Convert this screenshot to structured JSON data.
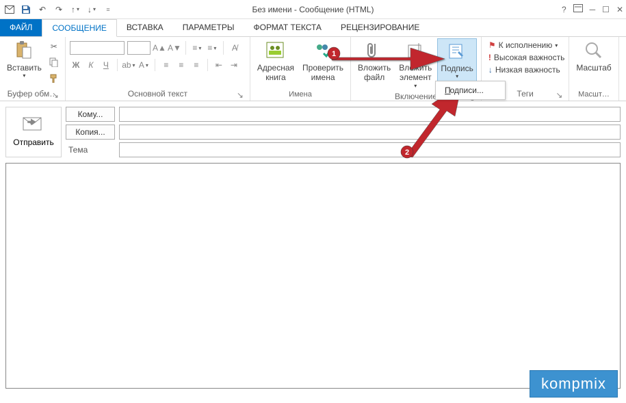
{
  "window": {
    "title": "Без имени - Сообщение (HTML)"
  },
  "tabs": {
    "file": "ФАЙЛ",
    "message": "СООБЩЕНИЕ",
    "insert": "ВСТАВКА",
    "options": "ПАРАМЕТРЫ",
    "format": "ФОРМАТ ТЕКСТА",
    "review": "РЕЦЕНЗИРОВАНИЕ"
  },
  "ribbon": {
    "clipboard": {
      "paste": "Вставить",
      "group": "Буфер обм…"
    },
    "font": {
      "bold": "Ж",
      "italic": "К",
      "underline": "Ч",
      "group": "Основной текст"
    },
    "names": {
      "addressbook": "Адресная\nкнига",
      "checknames": "Проверить\nимена",
      "group": "Имена"
    },
    "include": {
      "attachfile": "Вложить\nфайл",
      "attachitem": "Вложить\nэлемент",
      "signature": "Подпись",
      "group": "Включение"
    },
    "tags": {
      "followup": "К исполнению",
      "high": "Высокая важность",
      "low": "Низкая важность",
      "group": "Теги"
    },
    "zoom": {
      "label": "Масштаб",
      "group": "Масшт…"
    }
  },
  "dropdown": {
    "signatures": "Подписи..."
  },
  "compose": {
    "send": "Отправить",
    "to": "Кому...",
    "cc": "Копия...",
    "subject": "Тема",
    "to_value": "",
    "cc_value": "",
    "subject_value": ""
  },
  "annotations": {
    "num1": "1",
    "num2": "2"
  },
  "watermark": "kompmix"
}
